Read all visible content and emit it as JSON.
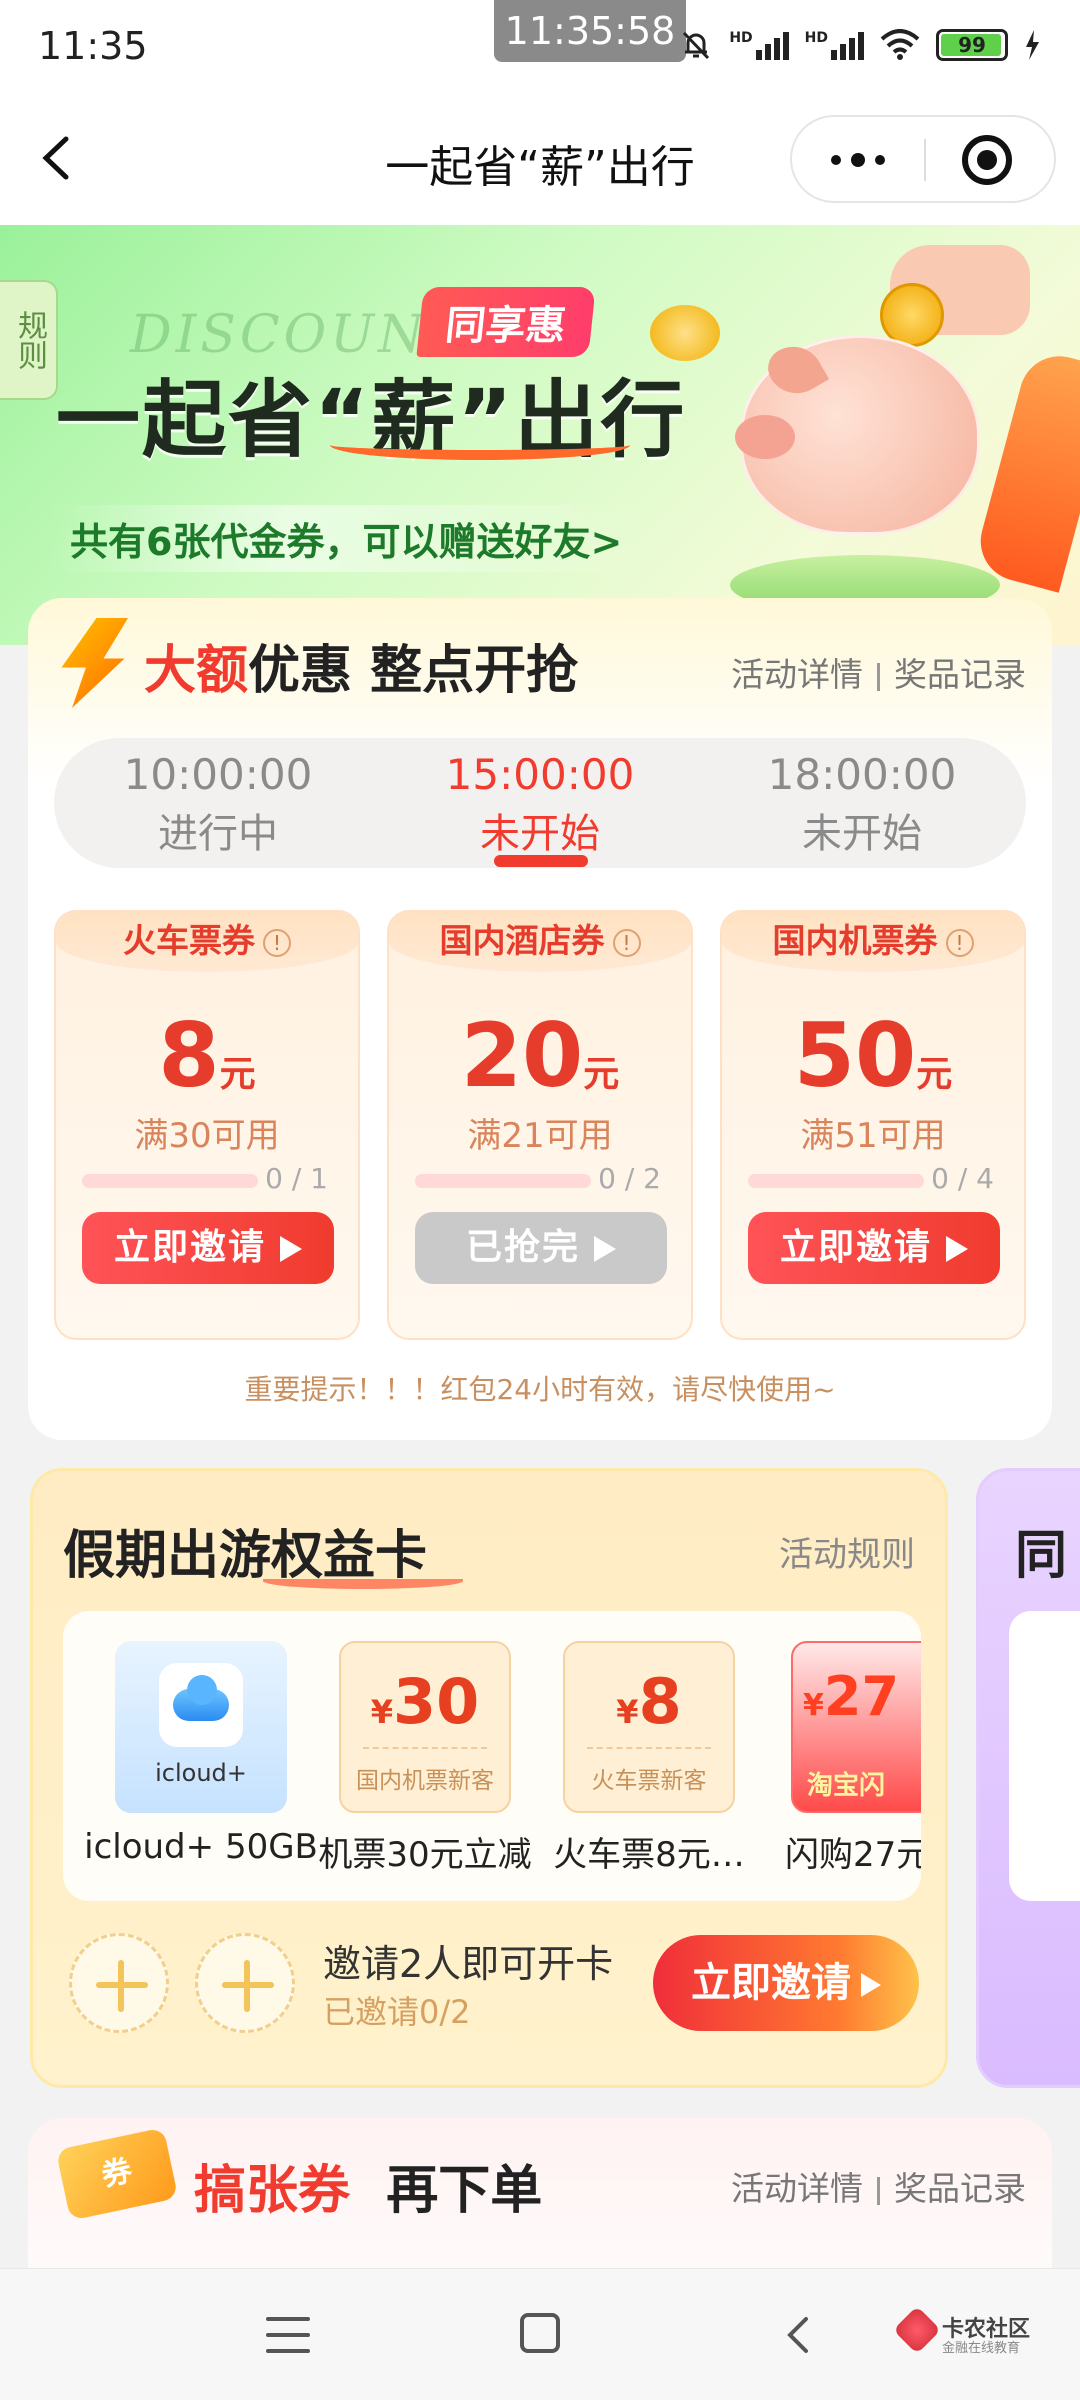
{
  "status_bar": {
    "time": "11:35",
    "clock_overlay": "11:35:58",
    "network_label_1": "HD",
    "network_label_2": "HD",
    "battery": "99",
    "battery_level": 0.99
  },
  "nav": {
    "title": "一起省“薪”出行"
  },
  "banner": {
    "rules_tab": "规则",
    "script_text": "DISCOUNT",
    "badge": "同享惠",
    "title": "一起省“薪”出行",
    "subtitle": "共有6张代金券，可以赠送好友>"
  },
  "big_discount": {
    "title_red": "大额",
    "title_rest": "优惠  整点开抢",
    "link_details": "活动详情",
    "link_records": "奖品记录",
    "time_tabs": [
      {
        "time": "10:00:00",
        "status": "进行中",
        "active": false
      },
      {
        "time": "15:00:00",
        "status": "未开始",
        "active": true
      },
      {
        "time": "18:00:00",
        "status": "未开始",
        "active": false
      }
    ],
    "coupons": [
      {
        "name": "火车票券",
        "info": "!",
        "amount": "8",
        "unit": "元",
        "condition": "满30可用",
        "progress": "0 / 1",
        "progress_value": 0,
        "button": "立即邀请",
        "enabled": true
      },
      {
        "name": "国内酒店券",
        "info": "!",
        "amount": "20",
        "unit": "元",
        "condition": "满21可用",
        "progress": "0 / 2",
        "progress_value": 0,
        "button": "已抢完",
        "enabled": false
      },
      {
        "name": "国内机票券",
        "info": "!",
        "amount": "50",
        "unit": "元",
        "condition": "满51可用",
        "progress": "0 / 4",
        "progress_value": 0,
        "button": "立即邀请",
        "enabled": true
      }
    ],
    "notice": "重要提示！！！红包24小时有效，请尽快使用~"
  },
  "holiday_card": {
    "title": "假期出游权益卡",
    "rules_link": "活动规则",
    "perks": [
      {
        "type": "icloud",
        "label": "icloud+",
        "name": "icloud+ 50GB"
      },
      {
        "type": "ticket",
        "currency": "¥",
        "value": "30",
        "label": "国内机票新客",
        "name": "机票30元立减"
      },
      {
        "type": "ticket",
        "currency": "¥",
        "value": "8",
        "label": "火车票新客",
        "name": "火车票8元…"
      },
      {
        "type": "taobao",
        "currency": "¥",
        "value": "27",
        "label": "淘宝闪",
        "name": "闪购27元"
      }
    ],
    "invite_text": "邀请2人即可开卡",
    "invited_count": "已邀请0/2",
    "invite_button": "立即邀请"
  },
  "next_card": {
    "title_partial": "同"
  },
  "coupon_card": {
    "icon_text": "券",
    "title_red": "搞张券",
    "title_rest": "再下单",
    "link_details": "活动详情",
    "link_records": "奖品记录"
  },
  "watermark": {
    "name": "卡农社区",
    "sub": "金融在线教育"
  },
  "colors": {
    "accent_red": "#f03b2e",
    "banner_green": "#9af19a",
    "disabled_gray": "#c9c9c9"
  }
}
